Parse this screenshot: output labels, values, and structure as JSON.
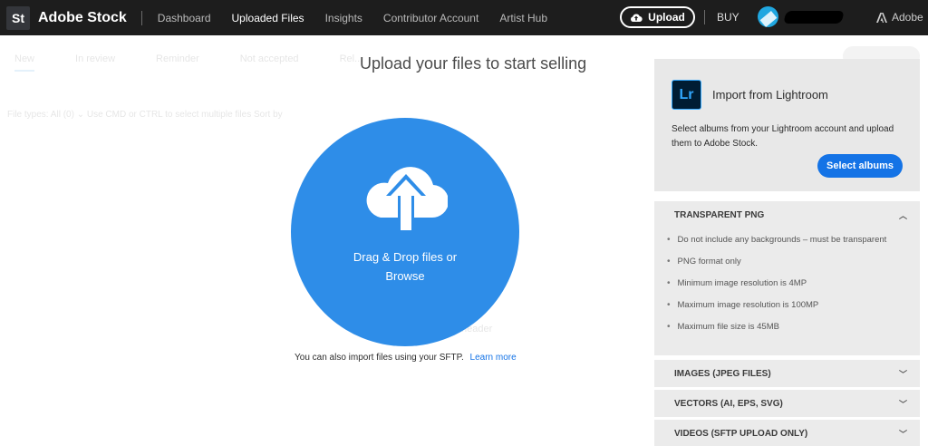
{
  "header": {
    "logo": "St",
    "brand": "Adobe Stock",
    "nav": [
      {
        "label": "Dashboard",
        "active": false
      },
      {
        "label": "Uploaded Files",
        "active": true
      },
      {
        "label": "Insights",
        "active": false
      },
      {
        "label": "Contributor Account",
        "active": false
      },
      {
        "label": "Artist Hub",
        "active": false
      }
    ],
    "upload_label": "Upload",
    "buy_label": "BUY",
    "adobe_label": "Adobe"
  },
  "background": {
    "tabs": [
      "New",
      "In review",
      "Reminder",
      "Not accepted",
      "Rel..."
    ],
    "filter_text": "File types: All (0)  ⌄      Use CMD or CTRL to select multiple files        Sort by",
    "hint_text": "...lick Upload in the header"
  },
  "modal": {
    "title": "Upload your files to start selling",
    "drop_line1": "Drag & Drop files or",
    "drop_line2": "Browse",
    "sftp_text": "You can also import files using your SFTP.",
    "learn_more": "Learn more"
  },
  "lightroom": {
    "logo": "Lr",
    "title": "Import from Lightroom",
    "description": "Select albums from your Lightroom account and upload them to Adobe Stock.",
    "button": "Select albums"
  },
  "accordions": {
    "png": {
      "title": "TRANSPARENT PNG",
      "items": [
        "Do not include any backgrounds – must be transparent",
        "PNG format only",
        "Minimum image resolution is 4MP",
        "Maximum image resolution is 100MP",
        "Maximum file size is 45MB"
      ]
    },
    "images": {
      "title": "IMAGES (JPEG FILES)"
    },
    "vectors": {
      "title": "VECTORS (AI, EPS, SVG)"
    },
    "videos": {
      "title": "VIDEOS (SFTP UPLOAD ONLY)"
    }
  },
  "colors": {
    "topbar": "#1d1d1d",
    "accent": "#2e8de8",
    "button_blue": "#1473e6",
    "panel_bg": "#ebebeb"
  },
  "icons": {
    "upload": "cloud-upload-icon",
    "close": "close-icon",
    "expand": "chevron-up-icon",
    "collapse": "chevron-down-icon"
  }
}
